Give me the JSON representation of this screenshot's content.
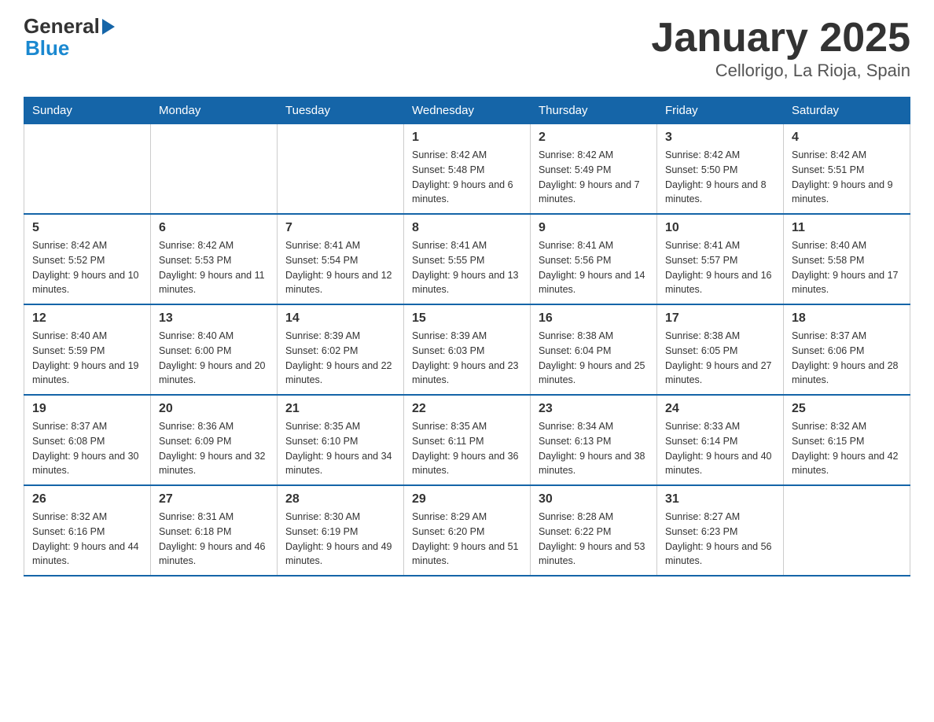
{
  "header": {
    "logo_line1_black": "General",
    "logo_line1_blue_arrow": "▶",
    "logo_line2": "Blue",
    "title": "January 2025",
    "subtitle": "Cellorigo, La Rioja, Spain"
  },
  "calendar": {
    "days_of_week": [
      "Sunday",
      "Monday",
      "Tuesday",
      "Wednesday",
      "Thursday",
      "Friday",
      "Saturday"
    ],
    "weeks": [
      [
        {
          "day": "",
          "info": ""
        },
        {
          "day": "",
          "info": ""
        },
        {
          "day": "",
          "info": ""
        },
        {
          "day": "1",
          "info": "Sunrise: 8:42 AM\nSunset: 5:48 PM\nDaylight: 9 hours and 6 minutes."
        },
        {
          "day": "2",
          "info": "Sunrise: 8:42 AM\nSunset: 5:49 PM\nDaylight: 9 hours and 7 minutes."
        },
        {
          "day": "3",
          "info": "Sunrise: 8:42 AM\nSunset: 5:50 PM\nDaylight: 9 hours and 8 minutes."
        },
        {
          "day": "4",
          "info": "Sunrise: 8:42 AM\nSunset: 5:51 PM\nDaylight: 9 hours and 9 minutes."
        }
      ],
      [
        {
          "day": "5",
          "info": "Sunrise: 8:42 AM\nSunset: 5:52 PM\nDaylight: 9 hours and 10 minutes."
        },
        {
          "day": "6",
          "info": "Sunrise: 8:42 AM\nSunset: 5:53 PM\nDaylight: 9 hours and 11 minutes."
        },
        {
          "day": "7",
          "info": "Sunrise: 8:41 AM\nSunset: 5:54 PM\nDaylight: 9 hours and 12 minutes."
        },
        {
          "day": "8",
          "info": "Sunrise: 8:41 AM\nSunset: 5:55 PM\nDaylight: 9 hours and 13 minutes."
        },
        {
          "day": "9",
          "info": "Sunrise: 8:41 AM\nSunset: 5:56 PM\nDaylight: 9 hours and 14 minutes."
        },
        {
          "day": "10",
          "info": "Sunrise: 8:41 AM\nSunset: 5:57 PM\nDaylight: 9 hours and 16 minutes."
        },
        {
          "day": "11",
          "info": "Sunrise: 8:40 AM\nSunset: 5:58 PM\nDaylight: 9 hours and 17 minutes."
        }
      ],
      [
        {
          "day": "12",
          "info": "Sunrise: 8:40 AM\nSunset: 5:59 PM\nDaylight: 9 hours and 19 minutes."
        },
        {
          "day": "13",
          "info": "Sunrise: 8:40 AM\nSunset: 6:00 PM\nDaylight: 9 hours and 20 minutes."
        },
        {
          "day": "14",
          "info": "Sunrise: 8:39 AM\nSunset: 6:02 PM\nDaylight: 9 hours and 22 minutes."
        },
        {
          "day": "15",
          "info": "Sunrise: 8:39 AM\nSunset: 6:03 PM\nDaylight: 9 hours and 23 minutes."
        },
        {
          "day": "16",
          "info": "Sunrise: 8:38 AM\nSunset: 6:04 PM\nDaylight: 9 hours and 25 minutes."
        },
        {
          "day": "17",
          "info": "Sunrise: 8:38 AM\nSunset: 6:05 PM\nDaylight: 9 hours and 27 minutes."
        },
        {
          "day": "18",
          "info": "Sunrise: 8:37 AM\nSunset: 6:06 PM\nDaylight: 9 hours and 28 minutes."
        }
      ],
      [
        {
          "day": "19",
          "info": "Sunrise: 8:37 AM\nSunset: 6:08 PM\nDaylight: 9 hours and 30 minutes."
        },
        {
          "day": "20",
          "info": "Sunrise: 8:36 AM\nSunset: 6:09 PM\nDaylight: 9 hours and 32 minutes."
        },
        {
          "day": "21",
          "info": "Sunrise: 8:35 AM\nSunset: 6:10 PM\nDaylight: 9 hours and 34 minutes."
        },
        {
          "day": "22",
          "info": "Sunrise: 8:35 AM\nSunset: 6:11 PM\nDaylight: 9 hours and 36 minutes."
        },
        {
          "day": "23",
          "info": "Sunrise: 8:34 AM\nSunset: 6:13 PM\nDaylight: 9 hours and 38 minutes."
        },
        {
          "day": "24",
          "info": "Sunrise: 8:33 AM\nSunset: 6:14 PM\nDaylight: 9 hours and 40 minutes."
        },
        {
          "day": "25",
          "info": "Sunrise: 8:32 AM\nSunset: 6:15 PM\nDaylight: 9 hours and 42 minutes."
        }
      ],
      [
        {
          "day": "26",
          "info": "Sunrise: 8:32 AM\nSunset: 6:16 PM\nDaylight: 9 hours and 44 minutes."
        },
        {
          "day": "27",
          "info": "Sunrise: 8:31 AM\nSunset: 6:18 PM\nDaylight: 9 hours and 46 minutes."
        },
        {
          "day": "28",
          "info": "Sunrise: 8:30 AM\nSunset: 6:19 PM\nDaylight: 9 hours and 49 minutes."
        },
        {
          "day": "29",
          "info": "Sunrise: 8:29 AM\nSunset: 6:20 PM\nDaylight: 9 hours and 51 minutes."
        },
        {
          "day": "30",
          "info": "Sunrise: 8:28 AM\nSunset: 6:22 PM\nDaylight: 9 hours and 53 minutes."
        },
        {
          "day": "31",
          "info": "Sunrise: 8:27 AM\nSunset: 6:23 PM\nDaylight: 9 hours and 56 minutes."
        },
        {
          "day": "",
          "info": ""
        }
      ]
    ]
  }
}
